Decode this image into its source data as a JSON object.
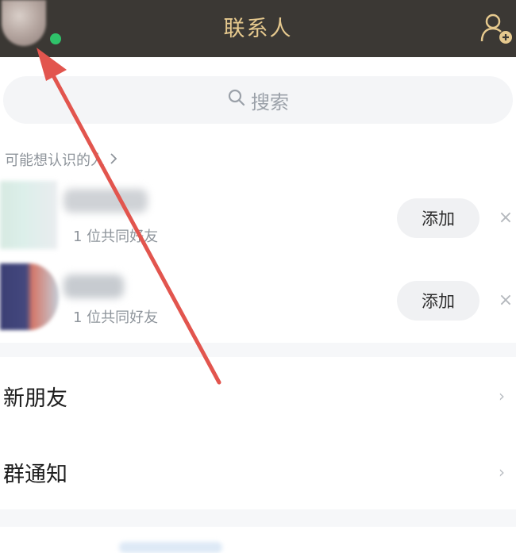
{
  "header": {
    "title": "联系人",
    "colors": {
      "background": "#3b3834",
      "title": "#e6c98e",
      "online": "#2fc26a"
    },
    "icons": {
      "add_contact": "add-contact-icon"
    }
  },
  "search": {
    "placeholder": "搜索",
    "icon": "search-icon"
  },
  "suggestions": {
    "heading": "可能想认识的人",
    "heading_icon": "chevron-right-icon",
    "items": [
      {
        "mutual": "1 位共同好友",
        "add_label": "添加",
        "dismiss_label": "×"
      },
      {
        "mutual": "1 位共同好友",
        "add_label": "添加",
        "dismiss_label": "×"
      }
    ]
  },
  "menu": {
    "items": [
      {
        "label": "新朋友",
        "chevron": "›"
      },
      {
        "label": "群通知",
        "chevron": "›"
      }
    ]
  },
  "annotation": {
    "arrow_color": "#e2554e"
  }
}
